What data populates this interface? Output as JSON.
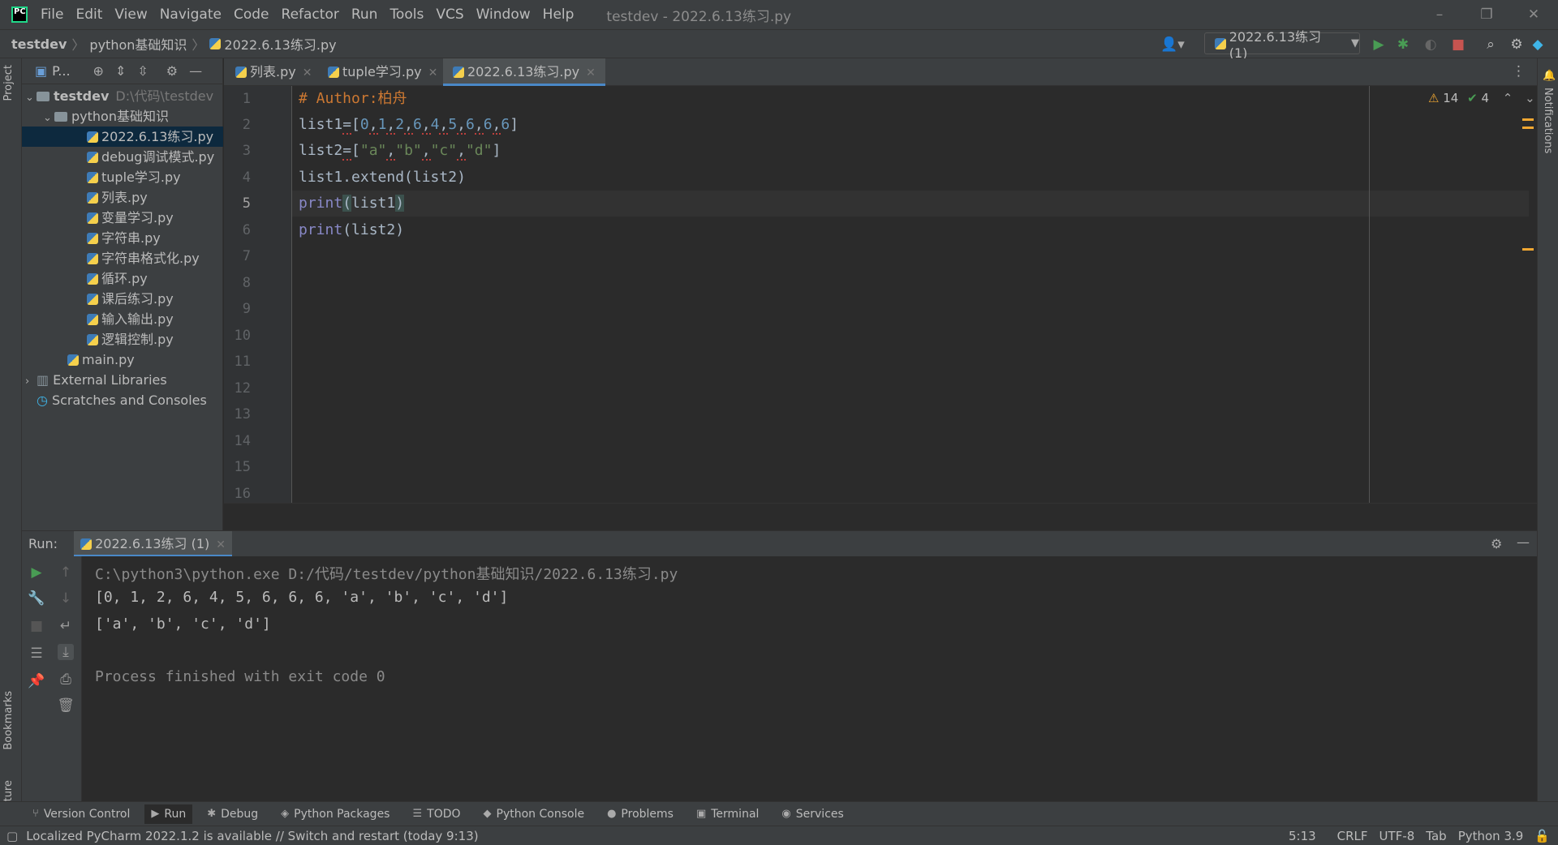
{
  "menu": [
    "File",
    "Edit",
    "View",
    "Navigate",
    "Code",
    "Refactor",
    "Run",
    "Tools",
    "VCS",
    "Window",
    "Help"
  ],
  "window_title": "testdev - 2022.6.13练习.py",
  "breadcrumbs": [
    "testdev",
    "python基础知识",
    "2022.6.13练习.py"
  ],
  "run_config": "2022.6.13练习 (1)",
  "project_panel": {
    "title": "P...",
    "tree": [
      {
        "label": "testdev",
        "hint": "D:\\代码\\testdev",
        "type": "folder-open"
      },
      {
        "label": "python基础知识",
        "type": "folder-open"
      },
      {
        "label": "2022.6.13练习.py",
        "type": "file",
        "selected": true
      },
      {
        "label": "debug调试模式.py",
        "type": "file"
      },
      {
        "label": "tuple学习.py",
        "type": "file"
      },
      {
        "label": "列表.py",
        "type": "file"
      },
      {
        "label": "变量学习.py",
        "type": "file"
      },
      {
        "label": "字符串.py",
        "type": "file"
      },
      {
        "label": "字符串格式化.py",
        "type": "file"
      },
      {
        "label": "循环.py",
        "type": "file"
      },
      {
        "label": "课后练习.py",
        "type": "file"
      },
      {
        "label": "输入输出.py",
        "type": "file"
      },
      {
        "label": "逻辑控制.py",
        "type": "file"
      },
      {
        "label": "main.py",
        "type": "file"
      },
      {
        "label": "External Libraries",
        "type": "folder-closed"
      },
      {
        "label": "Scratches and Consoles",
        "type": "special"
      }
    ]
  },
  "editor_tabs": [
    {
      "label": "列表.py"
    },
    {
      "label": "tuple学习.py"
    },
    {
      "label": "2022.6.13练习.py",
      "active": true
    }
  ],
  "line_numbers": [
    "1",
    "2",
    "3",
    "4",
    "5",
    "6",
    "7",
    "8",
    "9",
    "10",
    "11",
    "12",
    "13",
    "14",
    "15",
    "16"
  ],
  "code": {
    "l1": "# Author:柏舟",
    "l2_var": "list1",
    "l2_op": "=",
    "l2_items": [
      "0",
      "1",
      "2",
      "6",
      "4",
      "5",
      "6",
      "6",
      "6"
    ],
    "l3_var": "list2",
    "l3_op": "=",
    "l3_items": [
      "\"a\"",
      "\"b\"",
      "\"c\"",
      "\"d\""
    ],
    "l4": "list1.extend(list2)",
    "l5_fn": "print",
    "l5_arg": "list1",
    "l6_fn": "print",
    "l6_arg": "list2"
  },
  "inspections": {
    "warnings": "14",
    "weak": "4"
  },
  "run": {
    "label": "Run:",
    "tab": "2022.6.13练习 (1)",
    "output": [
      "C:\\python3\\python.exe D:/代码/testdev/python基础知识/2022.6.13练习.py",
      "[0, 1, 2, 6, 4, 5, 6, 6, 6, 'a', 'b', 'c', 'd']",
      "['a', 'b', 'c', 'd']",
      "",
      "Process finished with exit code 0"
    ]
  },
  "bottom_tabs": [
    "Version Control",
    "Run",
    "Debug",
    "Python Packages",
    "TODO",
    "Python Console",
    "Problems",
    "Terminal",
    "Services"
  ],
  "side_labels": {
    "project": "Project",
    "bookmarks": "Bookmarks",
    "structure": "Structure",
    "notifications": "Notifications"
  },
  "status": {
    "message": "Localized PyCharm 2022.1.2 is available // Switch and restart (today 9:13)",
    "position": "5:13",
    "line_sep": "CRLF",
    "encoding": "UTF-8",
    "indent": "Tab",
    "interpreter": "Python 3.9"
  },
  "colors": {
    "accent": "#4a88c7",
    "selection": "#0d293e",
    "keyword": "#8888c6",
    "string": "#6a8759",
    "number": "#6897bb",
    "comment": "#cc7832"
  }
}
